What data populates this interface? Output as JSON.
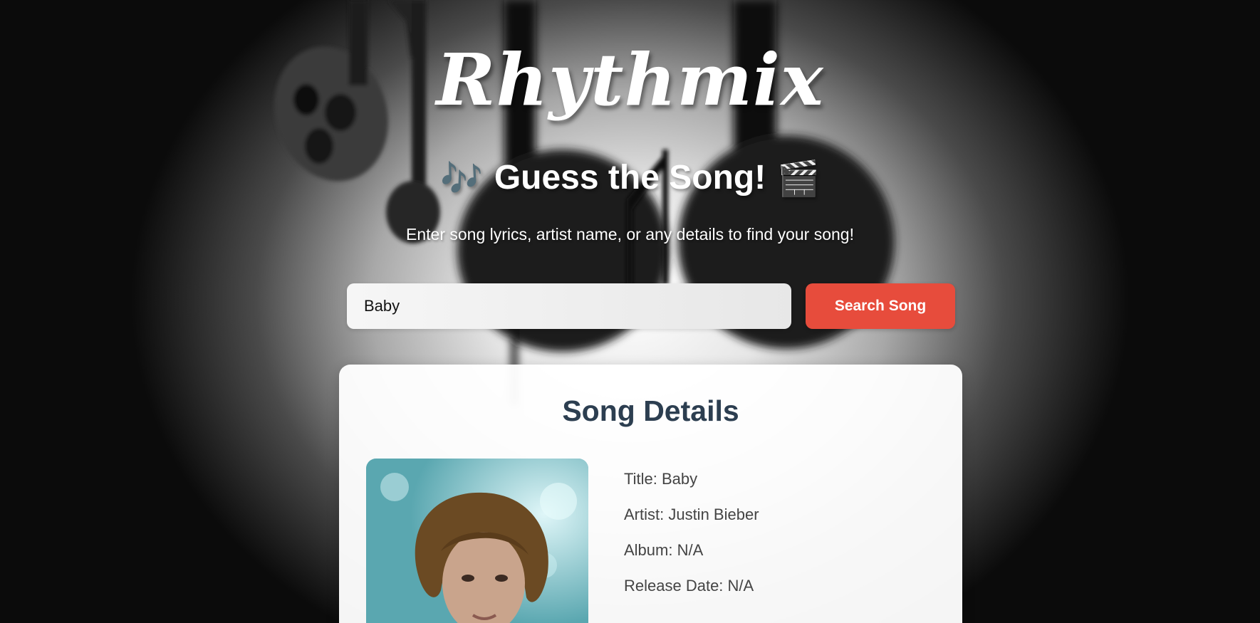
{
  "app": {
    "brand": "Rhythmix",
    "headline": "Guess the Song!",
    "headline_icon_left": "🎶",
    "headline_icon_right": "🎬",
    "tagline": "Enter song lyrics, artist name, or any details to find your song!"
  },
  "search": {
    "value": "Baby",
    "button_label": "Search Song"
  },
  "result": {
    "heading": "Song Details",
    "title": "Title: Baby",
    "artist": "Artist: Justin Bieber",
    "album": "Album: N/A",
    "release_date": "Release Date: N/A"
  },
  "colors": {
    "accent": "#e74c3c",
    "heading_dark": "#2c3e50"
  }
}
